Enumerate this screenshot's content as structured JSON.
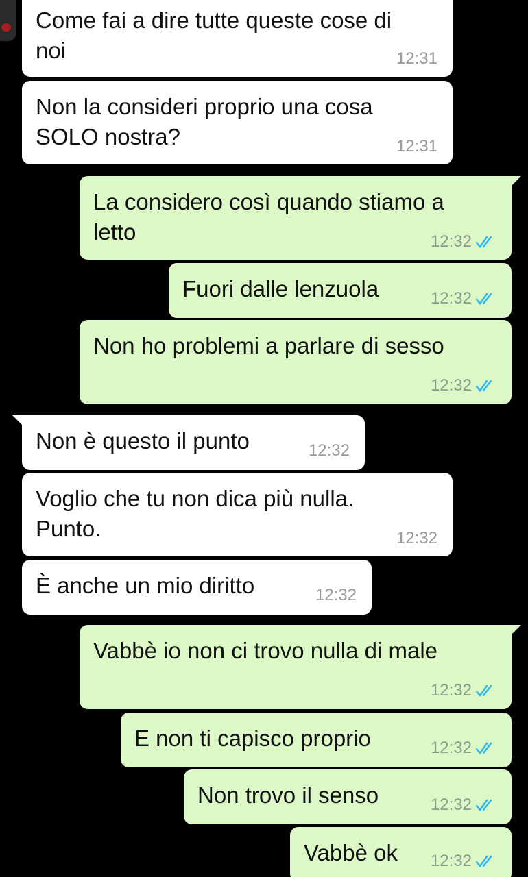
{
  "accent": {
    "read_tick": "#34b7f1",
    "outgoing_bubble": "#dcf8c6",
    "incoming_bubble": "#ffffff"
  },
  "messages": [
    {
      "dir": "in",
      "text": "Come fai a dire tutte queste cose di\nnoi",
      "time": "12:31"
    },
    {
      "dir": "in",
      "text": "Non la consideri proprio una cosa\nSOLO nostra?",
      "time": "12:31"
    },
    {
      "dir": "out",
      "text": "La considero così quando stiamo a\nletto",
      "time": "12:32",
      "status": "read-ticks-icon"
    },
    {
      "dir": "out",
      "text": "Fuori dalle lenzuola",
      "time": "12:32",
      "status": "read-ticks-icon"
    },
    {
      "dir": "out",
      "text": "Non ho problemi a parlare di sesso",
      "time": "12:32",
      "status": "read-ticks-icon"
    },
    {
      "dir": "in",
      "text": "Non è questo il punto",
      "time": "12:32"
    },
    {
      "dir": "in",
      "text": "Voglio che tu non dica più nulla.\nPunto.",
      "time": "12:32"
    },
    {
      "dir": "in",
      "text": "È anche un mio diritto",
      "time": "12:32"
    },
    {
      "dir": "out",
      "text": "Vabbè io non ci trovo nulla di male",
      "time": "12:32",
      "status": "read-ticks-icon"
    },
    {
      "dir": "out",
      "text": "E non ti capisco proprio",
      "time": "12:32",
      "status": "read-ticks-icon"
    },
    {
      "dir": "out",
      "text": "Non trovo il senso",
      "time": "12:32",
      "status": "read-ticks-icon"
    },
    {
      "dir": "out",
      "text": "Vabbè ok",
      "time": "12:32",
      "status": "read-ticks-icon"
    }
  ]
}
